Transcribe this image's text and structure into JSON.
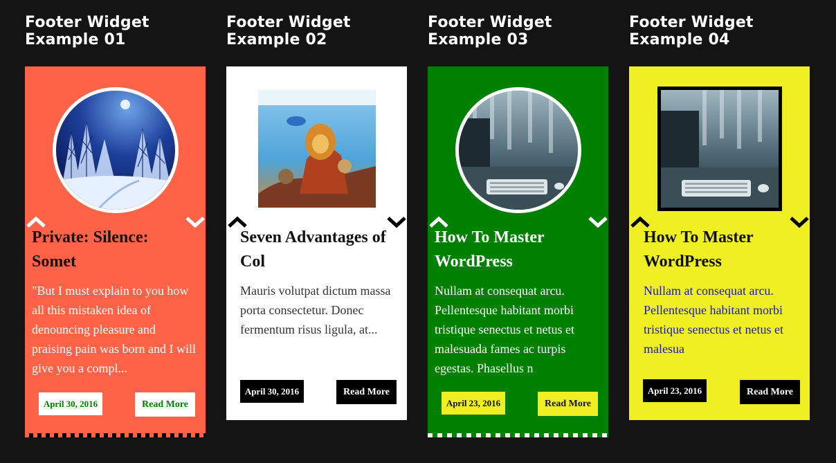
{
  "widgets": [
    {
      "heading": "Footer Widget Example 01",
      "post_title": "Private: Silence: Somet",
      "excerpt": "\"But I must explain to you how all this mistaken idea of denouncing pleasure and praising pain was born and I will give you a compl...",
      "date": "April 30, 2016",
      "read_more": "Read More",
      "image": "snowy-forest-night",
      "colors": {
        "background": "#ff6347",
        "text": "#ffffff",
        "date_bg": "#ffffff",
        "date_text": "#008000",
        "button_bg": "#ffffff",
        "button_text": "#008000",
        "arrow": "#ffffff"
      }
    },
    {
      "heading": "Footer Widget Example 02",
      "post_title": "Seven Advantages of Col",
      "excerpt": "Mauris volutpat dictum massa porta consectetur. Donec fermentum risus ligula, at...",
      "date": "April 30, 2016",
      "read_more": "Read More",
      "image": "lion-king-poster",
      "colors": {
        "background": "#ffffff",
        "text": "#111111",
        "date_bg": "#000000",
        "date_text": "#ffffff",
        "button_bg": "#000000",
        "button_text": "#ffffff",
        "arrow": "#000000"
      }
    },
    {
      "heading": "Footer Widget Example 03",
      "post_title": "How To Master WordPress",
      "excerpt": "Nullam at consequat arcu. Pellentesque habitant morbi tristique senectus et netus et malesuada fames ac turpis egestas. Phasellus n",
      "date": "April 23, 2016",
      "read_more": "Read More",
      "image": "desk-keyboard-monitor",
      "colors": {
        "background": "#008000",
        "text": "#ffffff",
        "date_bg": "#f0ef24",
        "date_text": "#111111",
        "button_bg": "#f0ef24",
        "button_text": "#111111",
        "arrow": "#ffffff"
      }
    },
    {
      "heading": "Footer Widget Example 04",
      "post_title": "How To Master WordPress",
      "excerpt": "Nullam at consequat arcu. Pellentesque habitant morbi tristique senectus et netus et malesua",
      "date": "April 23, 2016",
      "read_more": "Read More",
      "image": "desk-keyboard-monitor",
      "colors": {
        "background": "#f0ef24",
        "text": "#111111",
        "excerpt_text": "#1a1aa6",
        "date_bg": "#000000",
        "date_text": "#ffffff",
        "button_bg": "#000000",
        "button_text": "#ffffff",
        "arrow": "#000000"
      }
    }
  ]
}
